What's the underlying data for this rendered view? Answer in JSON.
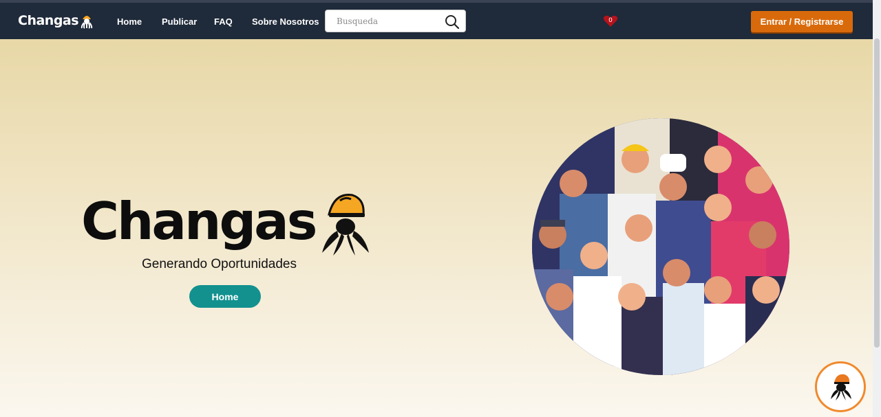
{
  "nav": {
    "brand": "Changas",
    "links": [
      "Home",
      "Publicar",
      "FAQ",
      "Sobre Nosotros"
    ],
    "search_placeholder": "Busqueda",
    "favorites_count": "0",
    "login_label": "Entrar / Registrarse"
  },
  "hero": {
    "title": "Changas",
    "tagline": "Generando Oportunidades",
    "button_label": "Home"
  },
  "colors": {
    "navbar": "#1f2a3a",
    "accent_orange": "#d96a0b",
    "teal": "#12918f"
  },
  "icons": [
    "octopus-helmet-logo",
    "search-icon",
    "heart-icon",
    "chat-icon"
  ]
}
